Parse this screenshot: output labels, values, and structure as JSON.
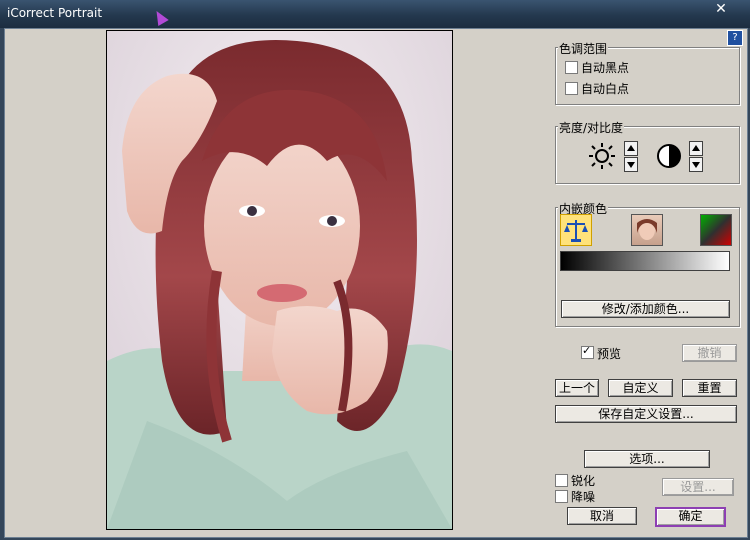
{
  "window": {
    "title": "iCorrect Portrait",
    "close": "✕",
    "help": "?"
  },
  "tone_range": {
    "title": "色调范围",
    "auto_black": {
      "label": "自动黑点",
      "checked": false
    },
    "auto_white": {
      "label": "自动白点",
      "checked": false
    }
  },
  "brightness_contrast": {
    "title": "亮度/对比度"
  },
  "memory_colors": {
    "title": "内嵌颜色",
    "modify_button": "修改/添加颜色..."
  },
  "preview": {
    "label": "预览",
    "checked": true
  },
  "buttons": {
    "undo": "撤销",
    "previous": "上一个",
    "custom": "自定义",
    "reset": "重置",
    "save_custom": "保存自定义设置...",
    "options": "选项...",
    "settings": "设置...",
    "cancel": "取消",
    "ok": "确定"
  },
  "sharpen": {
    "label": "锐化",
    "checked": false
  },
  "denoise": {
    "label": "降噪",
    "checked": false
  },
  "colors": {
    "default_button_border": "#8d3fb3",
    "title_bar": "#24384e",
    "dialog": "#d4d0c8"
  }
}
